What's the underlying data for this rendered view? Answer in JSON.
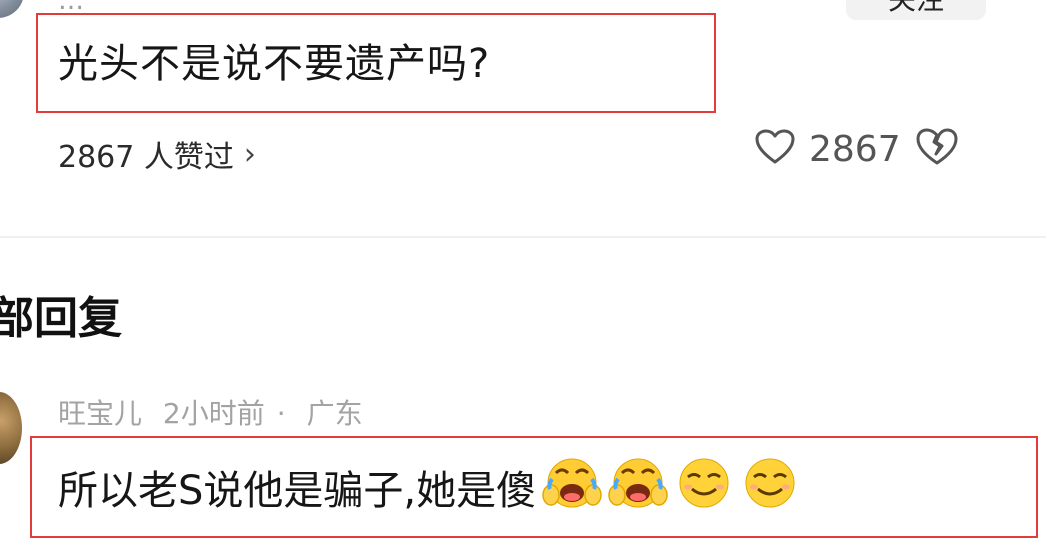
{
  "header": {
    "name_fragment": "…",
    "follow_button_label": "关注"
  },
  "comment": {
    "text": "光头不是说不要遗产吗?",
    "liked_by_text": "2867 人赞过",
    "like_count": "2867"
  },
  "replies_section": {
    "heading": "部回复"
  },
  "reply": {
    "username": "旺宝儿",
    "time": "2小时前",
    "separator": "·",
    "location": "广东",
    "text": "所以老S说他是骗子,她是傻",
    "emojis": [
      "laughing-cover-face-emoji",
      "laughing-cover-face-emoji",
      "smile-emoji",
      "smile-emoji"
    ]
  },
  "colors": {
    "highlight_border": "#e23b3b",
    "meta_gray": "#a3a3a3",
    "text_dark": "#161616"
  }
}
